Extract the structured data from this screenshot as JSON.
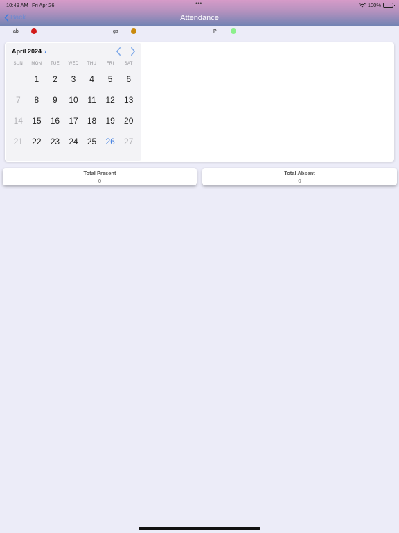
{
  "status_bar": {
    "time": "10:49 AM",
    "date": "Fri Apr 26",
    "dots": "•••",
    "battery": "100%"
  },
  "nav": {
    "back_label": "Back",
    "title": "Attendance"
  },
  "legend": [
    {
      "label": "ab",
      "color": "#D21A1A"
    },
    {
      "label": "ga",
      "color": "#C98A0C"
    },
    {
      "label": "P",
      "color": "#8CF08C"
    }
  ],
  "calendar": {
    "month_label": "April 2024",
    "weekdays": [
      "SUN",
      "MON",
      "TUE",
      "WED",
      "THU",
      "FRI",
      "SAT"
    ],
    "weeks": [
      [
        "",
        "1",
        "2",
        "3",
        "4",
        "5",
        "6"
      ],
      [
        "7",
        "8",
        "9",
        "10",
        "11",
        "12",
        "13"
      ],
      [
        "14",
        "15",
        "16",
        "17",
        "18",
        "19",
        "20"
      ],
      [
        "21",
        "22",
        "23",
        "24",
        "25",
        "26",
        "27"
      ]
    ],
    "faded_days": [
      "7",
      "14",
      "21",
      "27"
    ],
    "selected_day": "26",
    "accent_color": "#3B7BE0"
  },
  "totals": {
    "present_label": "Total Present",
    "present_value": "0",
    "absent_label": "Total Absent",
    "absent_value": "0"
  }
}
